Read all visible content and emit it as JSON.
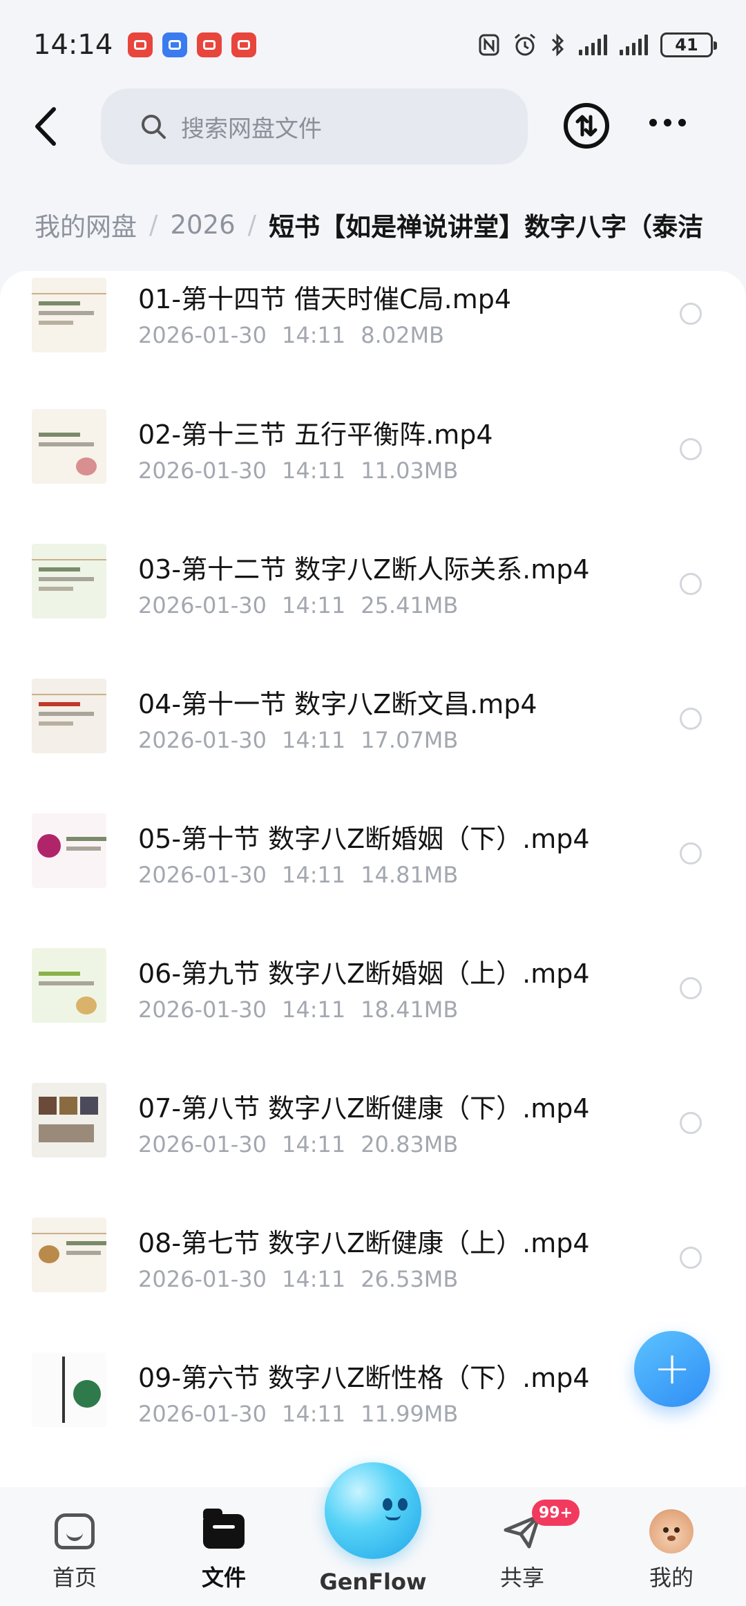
{
  "status_bar": {
    "time": "14:14",
    "notification_icons": [
      "huawei-store-icon",
      "qq-browser-icon",
      "red-app-icon",
      "red-app-icon"
    ],
    "system_icons": [
      "nfc-icon",
      "alarm-icon",
      "bluetooth-icon",
      "signal-icon",
      "signal-icon"
    ],
    "battery": "41"
  },
  "top_bar": {
    "search_placeholder": "搜索网盘文件",
    "icons": [
      "back-icon",
      "search-icon",
      "transfer-icon",
      "more-icon"
    ]
  },
  "breadcrumb": {
    "items": [
      "我的网盘",
      "2026"
    ],
    "current": "短书【如是禅说讲堂】数字八字（泰洁"
  },
  "files": [
    {
      "name": "01-第十四节 借天时催C局.mp4",
      "date": "2026-01-30",
      "time": "14:11",
      "size": "8.02MB"
    },
    {
      "name": "02-第十三节 五行平衡阵.mp4",
      "date": "2026-01-30",
      "time": "14:11",
      "size": "11.03MB"
    },
    {
      "name": "03-第十二节 数字八Z断人际关系.mp4",
      "date": "2026-01-30",
      "time": "14:11",
      "size": "25.41MB"
    },
    {
      "name": "04-第十一节 数字八Z断文昌.mp4",
      "date": "2026-01-30",
      "time": "14:11",
      "size": "17.07MB"
    },
    {
      "name": "05-第十节 数字八Z断婚姻（下）.mp4",
      "date": "2026-01-30",
      "time": "14:11",
      "size": "14.81MB"
    },
    {
      "name": "06-第九节 数字八Z断婚姻（上）.mp4",
      "date": "2026-01-30",
      "time": "14:11",
      "size": "18.41MB"
    },
    {
      "name": "07-第八节 数字八Z断健康（下）.mp4",
      "date": "2026-01-30",
      "time": "14:11",
      "size": "20.83MB"
    },
    {
      "name": "08-第七节 数字八Z断健康（上）.mp4",
      "date": "2026-01-30",
      "time": "14:11",
      "size": "26.53MB"
    },
    {
      "name": "09-第六节 数字八Z断性格（下）.mp4",
      "date": "2026-01-30",
      "time": "14:11",
      "size": "11.99MB"
    }
  ],
  "fab": {
    "symbol": "+",
    "icon": "plus-icon"
  },
  "bottom_nav": {
    "items": [
      {
        "label": "首页",
        "icon": "home-icon",
        "active": false
      },
      {
        "label": "文件",
        "icon": "folder-icon",
        "active": true
      },
      {
        "label": "GenFlow",
        "icon": "genflow-orb-icon",
        "active": false
      },
      {
        "label": "共享",
        "icon": "paper-plane-icon",
        "active": false,
        "badge": "99+"
      },
      {
        "label": "我的",
        "icon": "avatar-icon",
        "active": false
      }
    ]
  },
  "colors": {
    "accent": "#2f8df5",
    "badge": "#f23a5e",
    "background": "#f3f5f9",
    "card": "#ffffff"
  }
}
